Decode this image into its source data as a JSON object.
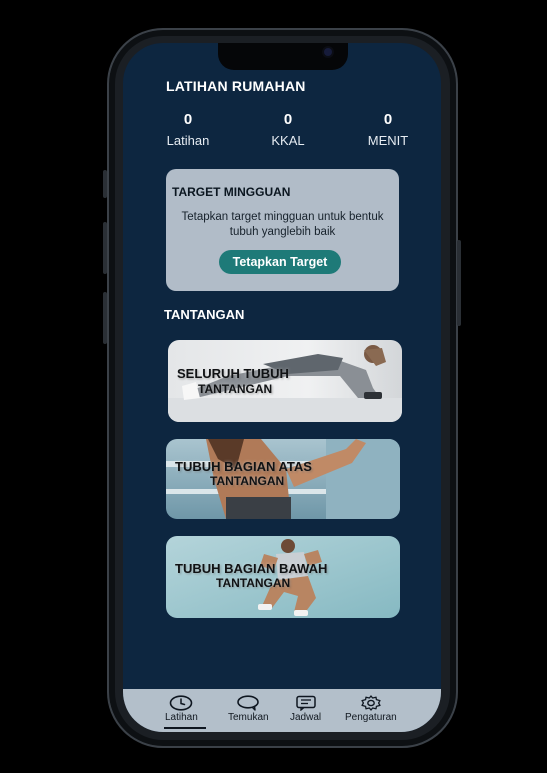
{
  "header": {
    "title": "LATIHAN RUMAHAN"
  },
  "stats": [
    {
      "value": "0",
      "label": "Latihan"
    },
    {
      "value": "0",
      "label": "KKAL"
    },
    {
      "value": "0",
      "label": "MENIT"
    }
  ],
  "weekly_target": {
    "title": "TARGET MINGGUAN",
    "description": "Tetapkan target mingguan untuk bentuk tubuh yanglebih baik",
    "button_label": "Tetapkan Target"
  },
  "challenges": {
    "section_title": "TANTANGAN",
    "items": [
      {
        "title": "SELURUH TUBUH",
        "subtitle": "TANTANGAN"
      },
      {
        "title": "TUBUH BAGIAN ATAS",
        "subtitle": "TANTANGAN"
      },
      {
        "title": "TUBUH BAGIAN BAWAH",
        "subtitle": "TANTANGAN"
      }
    ]
  },
  "nav": {
    "items": [
      {
        "label": "Latihan",
        "icon": "clock-icon",
        "active": true
      },
      {
        "label": "Temukan",
        "icon": "chat-bubble-icon",
        "active": false
      },
      {
        "label": "Jadwal",
        "icon": "message-square-icon",
        "active": false
      },
      {
        "label": "Pengaturan",
        "icon": "gear-icon",
        "active": false
      }
    ]
  },
  "colors": {
    "screen_background": "#0d2640",
    "card_background": "#b1bcc8",
    "accent_button": "#1e7a78",
    "nav_background": "#b3bfca"
  }
}
